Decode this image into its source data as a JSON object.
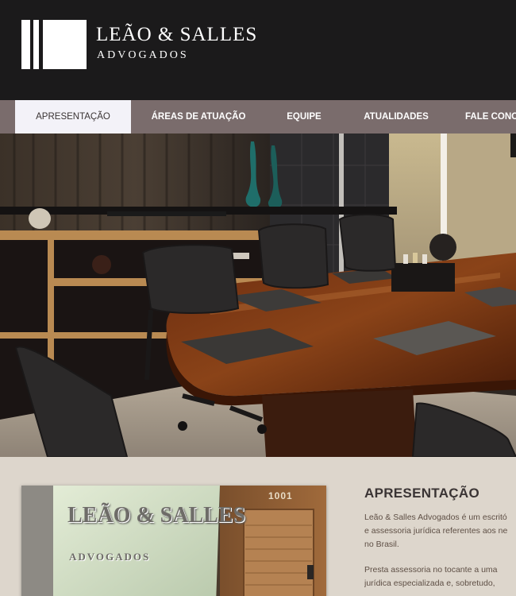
{
  "brand": {
    "name": "LEÃO & SALLES",
    "subtitle": "ADVOGADOS"
  },
  "nav": {
    "items": [
      {
        "label": "APRESENTAÇÃO",
        "active": true
      },
      {
        "label": "ÁREAS DE ATUAÇÃO",
        "active": false
      },
      {
        "label": "EQUIPE",
        "active": false
      },
      {
        "label": "ATUALIDADES",
        "active": false
      },
      {
        "label": "FALE CONO",
        "active": false
      }
    ]
  },
  "hero": {
    "image": "conference-room-photo"
  },
  "intro": {
    "title": "APRESENTAÇÃO",
    "paragraph_1_lines": [
      "Leão & Salles Advogados é um escritó",
      "e assessoria jurídica referentes aos ne",
      "no Brasil."
    ],
    "paragraph_2_lines": [
      "Presta assessoria no tocante a uma",
      "jurídica especializada e, sobretudo,"
    ],
    "photo": {
      "sign_name": "LEÃO & SALLES",
      "sign_sub": "ADVOGADOS",
      "door_number": "1001"
    }
  },
  "colors": {
    "header_bg": "#1b1a1b",
    "nav_bg": "#7a6c6c",
    "nav_active_bg": "#f3f2f8",
    "content_bg": "#ddd6cc",
    "title_color": "#3a3434",
    "text_color": "#5e4f45"
  }
}
